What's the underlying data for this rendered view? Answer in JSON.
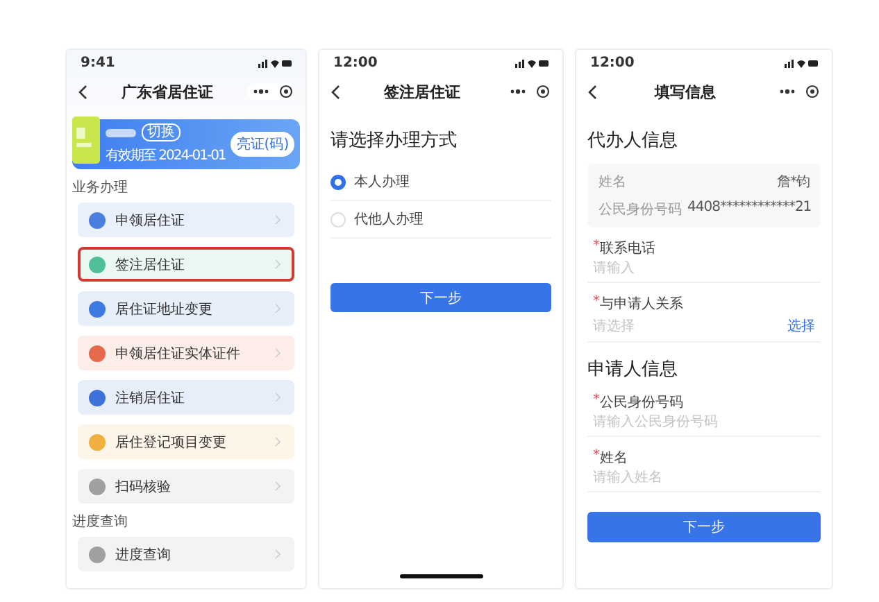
{
  "screen1": {
    "status_time": "9:41",
    "title": "广东省居住证",
    "card": {
      "switch_label": "切换",
      "validity": "有效期至 2024-01-01",
      "show_button": "亮证(码)"
    },
    "sections": [
      {
        "label": "业务办理",
        "items": [
          {
            "label": "申领居住证",
            "color": "#4a7fe0",
            "selected": false
          },
          {
            "label": "签注居住证",
            "color": "#4fbf9a",
            "selected": true
          },
          {
            "label": "居住证地址变更",
            "color": "#3d7be0",
            "selected": false
          },
          {
            "label": "申领居住证实体证件",
            "color": "#e5694a",
            "selected": false
          },
          {
            "label": "注销居住证",
            "color": "#3d72d8",
            "selected": false
          },
          {
            "label": "居住登记项目变更",
            "color": "#f0b040",
            "selected": false
          },
          {
            "label": "扫码核验",
            "color": "#a0a0a0",
            "selected": false
          }
        ]
      },
      {
        "label": "进度查询",
        "items": [
          {
            "label": "进度查询",
            "color": "#a0a0a0",
            "selected": false
          }
        ]
      }
    ]
  },
  "screen2": {
    "status_time": "12:00",
    "title": "签注居住证",
    "question": "请选择办理方式",
    "options": [
      {
        "label": "本人办理",
        "selected": true
      },
      {
        "label": "代他人办理",
        "selected": false
      }
    ],
    "button": "下一步"
  },
  "screen3": {
    "status_time": "12:00",
    "title": "填写信息",
    "agent_heading": "代办人信息",
    "agent_info": [
      {
        "label": "姓名",
        "value": "詹*钧"
      },
      {
        "label": "公民身份号码",
        "value": "4408************21"
      }
    ],
    "agent_fields": [
      {
        "mark": "*",
        "label": "联系电话",
        "placeholder": "请输入"
      },
      {
        "mark": "*",
        "label": "与申请人关系",
        "placeholder": "请选择",
        "action": "选择"
      }
    ],
    "applicant_heading": "申请人信息",
    "applicant_fields": [
      {
        "mark": "*",
        "label": "公民身份号码",
        "placeholder": "请输入公民身份号码"
      },
      {
        "mark": "*",
        "label": "姓名",
        "placeholder": "请输入姓名"
      }
    ],
    "button": "下一步"
  }
}
